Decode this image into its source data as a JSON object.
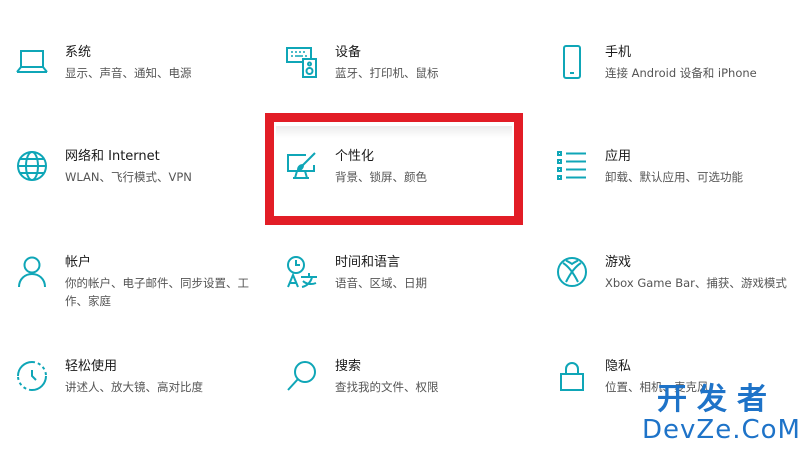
{
  "accent_color": "#0fa6b7",
  "highlight_color": "#e21d26",
  "tiles": [
    {
      "title": "系统",
      "desc": "显示、声音、通知、电源",
      "icon": "laptop-icon"
    },
    {
      "title": "设备",
      "desc": "蓝牙、打印机、鼠标",
      "icon": "keyboard-speaker-icon"
    },
    {
      "title": "手机",
      "desc": "连接 Android 设备和 iPhone",
      "icon": "phone-icon"
    },
    {
      "title": "网络和 Internet",
      "desc": "WLAN、飞行模式、VPN",
      "icon": "globe-icon"
    },
    {
      "title": "个性化",
      "desc": "背景、锁屏、颜色",
      "icon": "paint-monitor-icon"
    },
    {
      "title": "应用",
      "desc": "卸载、默认应用、可选功能",
      "icon": "app-list-icon"
    },
    {
      "title": "帐户",
      "desc": "你的帐户、电子邮件、同步设置、工作、家庭",
      "icon": "person-icon"
    },
    {
      "title": "时间和语言",
      "desc": "语音、区域、日期",
      "icon": "time-language-icon"
    },
    {
      "title": "游戏",
      "desc": "Xbox Game Bar、捕获、游戏模式",
      "icon": "xbox-icon"
    },
    {
      "title": "轻松使用",
      "desc": "讲述人、放大镜、高对比度",
      "icon": "ease-of-access-icon"
    },
    {
      "title": "搜索",
      "desc": "查找我的文件、权限",
      "icon": "search-icon"
    },
    {
      "title": "隐私",
      "desc": "位置、相机、麦克风",
      "icon": "lock-icon"
    }
  ],
  "watermark": {
    "cn": "开发者",
    "en": "DevZe.CoM"
  }
}
